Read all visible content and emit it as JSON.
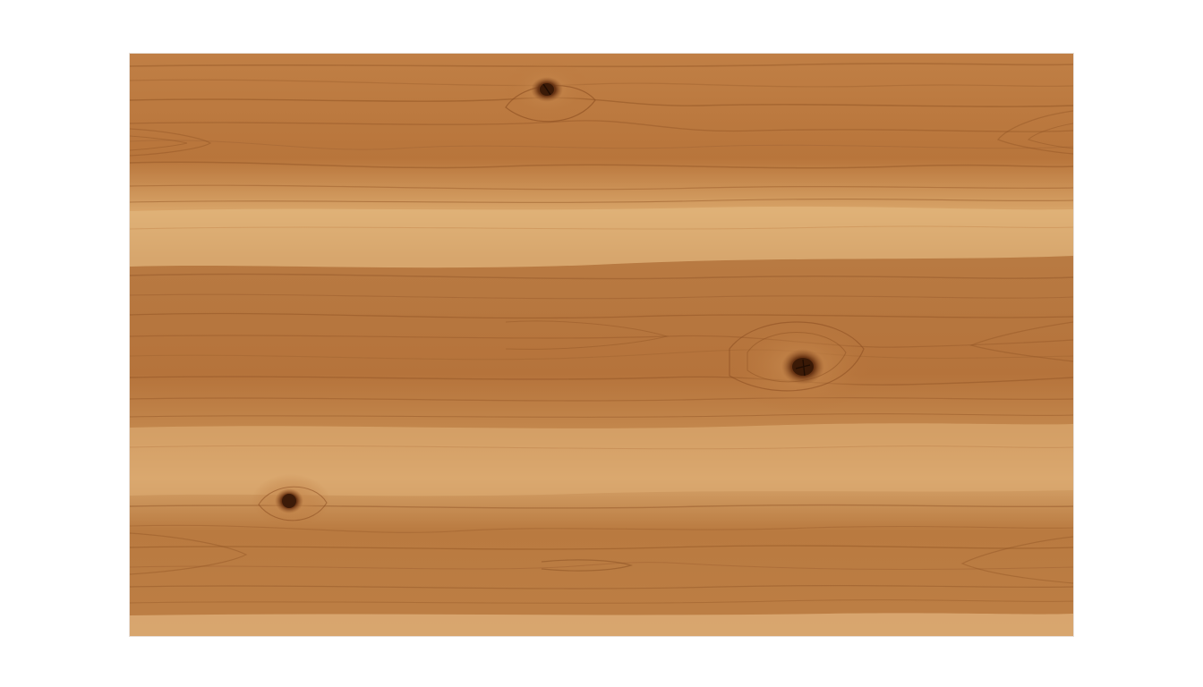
{
  "scene": {
    "subject": "wood-board",
    "colors": {
      "background": "#ffffff",
      "wood_base": "#b9773f",
      "wood_dark": "#8f5326",
      "wood_light": "#e0b27a",
      "sapwood": "#efcf9c",
      "knot": "#5a2e12"
    },
    "knot_count": 3
  }
}
